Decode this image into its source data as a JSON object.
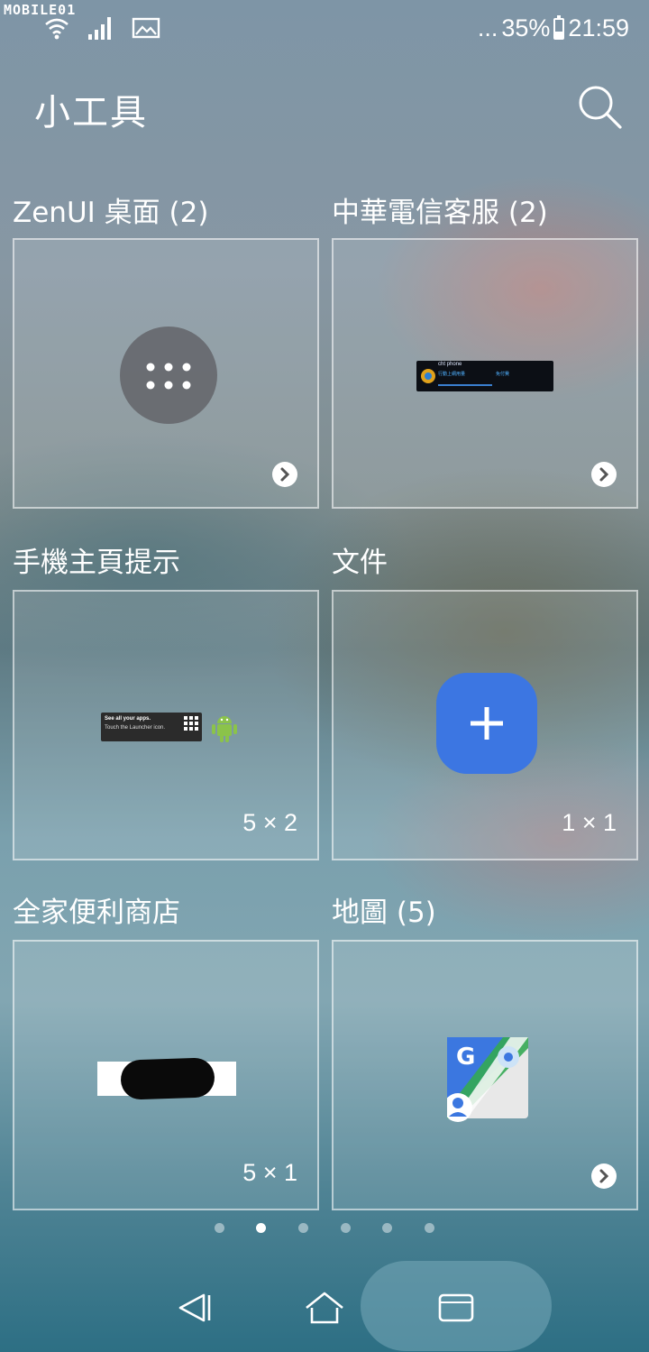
{
  "status_bar": {
    "watermark": "MOBILE01",
    "signal_dots": "...",
    "battery_percent": "35%",
    "battery_level": 0.35,
    "time": "21:59",
    "icons": [
      "wifi-icon",
      "signal-icon",
      "image-icon",
      "battery-icon"
    ]
  },
  "header": {
    "title": "小工具",
    "search_icon": "search-icon"
  },
  "widgets": [
    {
      "title": "ZenUI 桌面 (2)",
      "size": "",
      "has_more": true,
      "preview": "launcher-dots"
    },
    {
      "title": "中華電信客服 (2)",
      "size": "",
      "has_more": true,
      "preview": "cht-phone",
      "preview_text": {
        "title": "cht phone",
        "left": "行動上網用量",
        "right": "免付費"
      }
    },
    {
      "title": "手機主頁提示",
      "size": "5 × 2",
      "has_more": false,
      "preview": "launcher-tip",
      "preview_text": {
        "line1": "See all your apps.",
        "line2": "Touch the Launcher icon."
      }
    },
    {
      "title": "文件",
      "size": "1 × 1",
      "has_more": false,
      "preview": "docs-add"
    },
    {
      "title": "全家便利商店",
      "size": "5 × 1",
      "has_more": false,
      "preview": "familymart-banner"
    },
    {
      "title": "地圖 (5)",
      "size": "",
      "has_more": true,
      "preview": "google-maps"
    }
  ],
  "pager": {
    "count": 6,
    "active_index": 1
  },
  "nav_bar": {
    "buttons": [
      "back-icon",
      "home-icon",
      "recents-icon"
    ]
  }
}
